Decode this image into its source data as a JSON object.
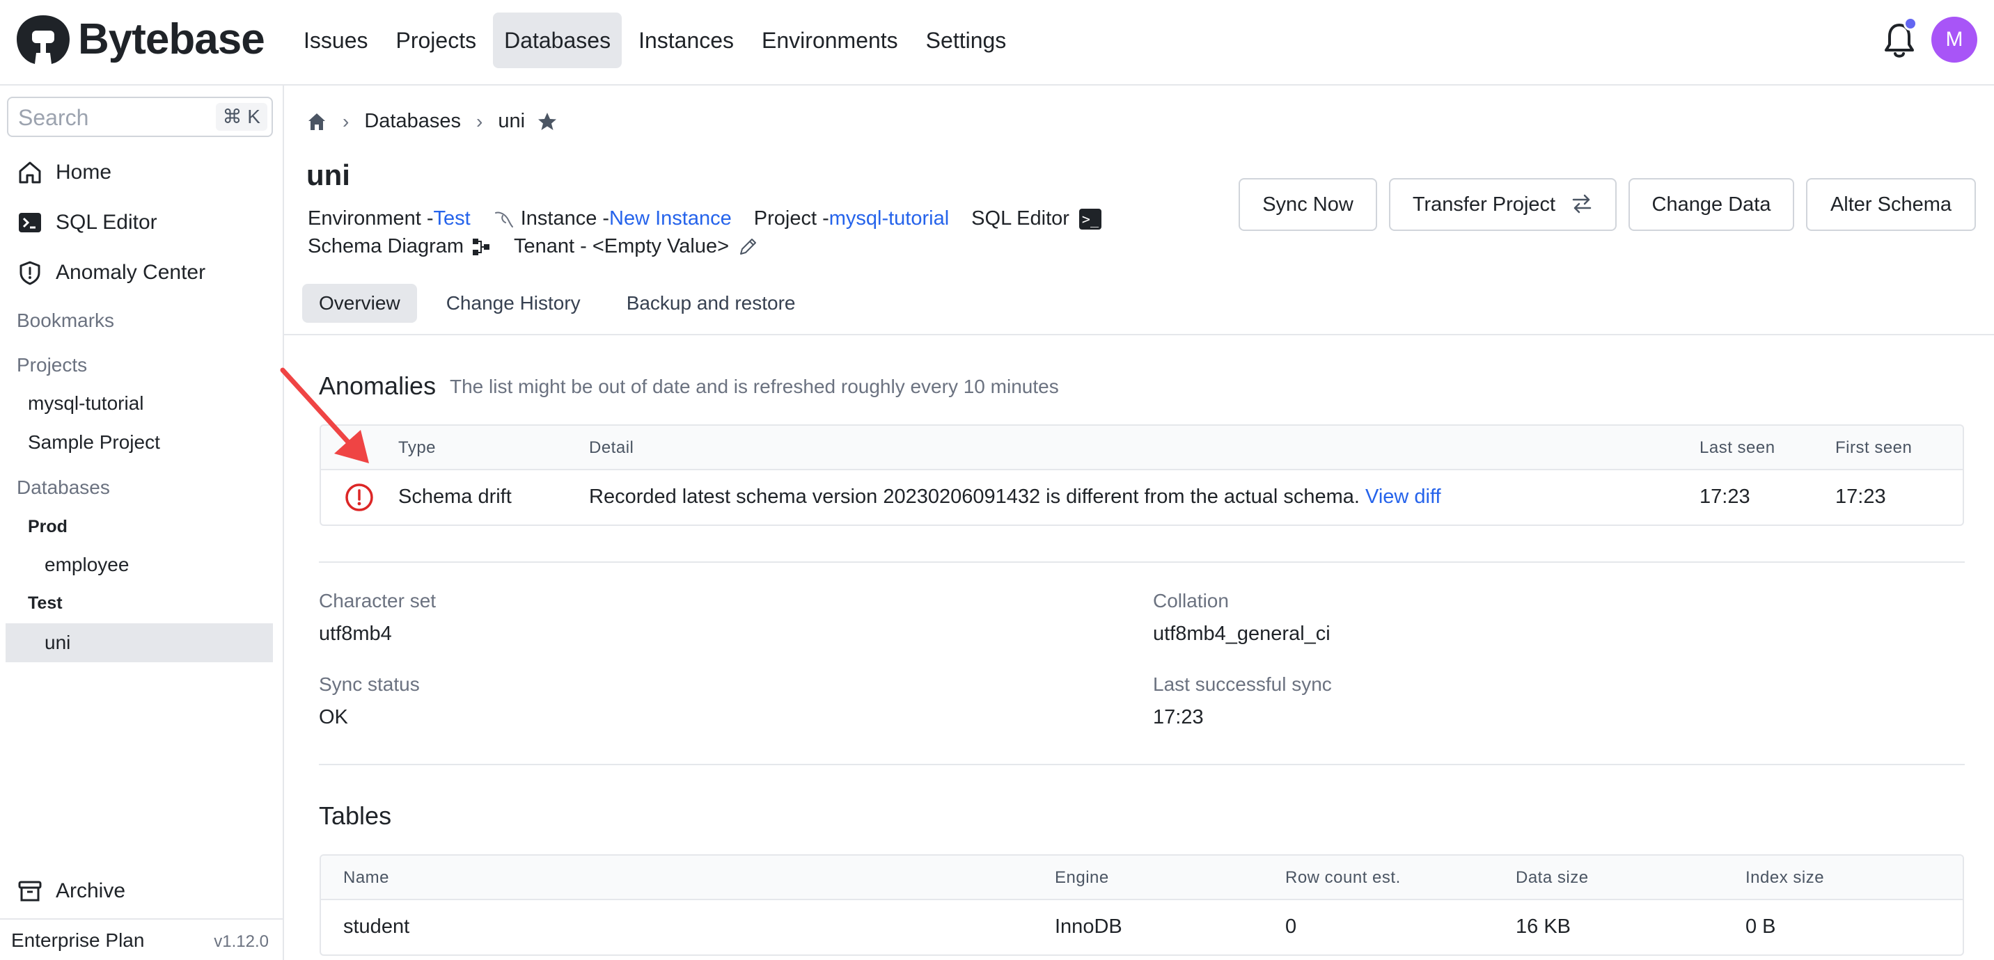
{
  "brand": {
    "name": "Bytebase"
  },
  "nav": {
    "items": [
      {
        "label": "Issues"
      },
      {
        "label": "Projects"
      },
      {
        "label": "Databases",
        "active": true
      },
      {
        "label": "Instances"
      },
      {
        "label": "Environments"
      },
      {
        "label": "Settings"
      }
    ],
    "avatar_initial": "M"
  },
  "sidebar": {
    "search_placeholder": "Search",
    "search_shortcut": "⌘ K",
    "links": {
      "home": "Home",
      "sql_editor": "SQL Editor",
      "anomaly_center": "Anomaly Center",
      "archive": "Archive"
    },
    "bookmarks_label": "Bookmarks",
    "projects_label": "Projects",
    "projects": [
      "mysql-tutorial",
      "Sample Project"
    ],
    "databases_label": "Databases",
    "environments": [
      {
        "name": "Prod",
        "databases": [
          "employee"
        ]
      },
      {
        "name": "Test",
        "databases": [
          "uni"
        ]
      }
    ],
    "plan": "Enterprise Plan",
    "version": "v1.12.0"
  },
  "breadcrumb": {
    "section": "Databases",
    "current": "uni"
  },
  "database": {
    "name": "uni",
    "environment_label": "Environment - ",
    "environment": "Test",
    "instance_label": "Instance - ",
    "instance": "New Instance",
    "project_label": "Project - ",
    "project": "mysql-tutorial",
    "sql_editor_label": "SQL Editor",
    "schema_diagram_label": "Schema Diagram",
    "tenant_label": "Tenant - <Empty Value>"
  },
  "actions": {
    "sync_now": "Sync Now",
    "transfer_project": "Transfer Project",
    "change_data": "Change Data",
    "alter_schema": "Alter Schema"
  },
  "tabs": [
    {
      "label": "Overview",
      "active": true
    },
    {
      "label": "Change History"
    },
    {
      "label": "Backup and restore"
    }
  ],
  "anomalies": {
    "title": "Anomalies",
    "note": "The list might be out of date and is refreshed roughly every 10 minutes",
    "columns": {
      "type": "Type",
      "detail": "Detail",
      "last_seen": "Last seen",
      "first_seen": "First seen"
    },
    "rows": [
      {
        "type": "Schema drift",
        "detail": "Recorded latest schema version 20230206091432 is different from the actual schema.",
        "detail_link": "View diff",
        "last_seen": "17:23",
        "first_seen": "17:23"
      }
    ]
  },
  "info": {
    "character_set_label": "Character set",
    "character_set": "utf8mb4",
    "collation_label": "Collation",
    "collation": "utf8mb4_general_ci",
    "sync_status_label": "Sync status",
    "sync_status": "OK",
    "last_sync_label": "Last successful sync",
    "last_sync": "17:23"
  },
  "tables": {
    "title": "Tables",
    "columns": {
      "name": "Name",
      "engine": "Engine",
      "rows": "Row count est.",
      "data_size": "Data size",
      "index_size": "Index size"
    },
    "rows": [
      {
        "name": "student",
        "engine": "InnoDB",
        "rows": "0",
        "data_size": "16 KB",
        "index_size": "0 B"
      }
    ]
  },
  "colors": {
    "accent": "#2563eb",
    "warning": "#dc2626",
    "annotation_arrow": "#ef4444",
    "avatar": "#a855f7"
  }
}
